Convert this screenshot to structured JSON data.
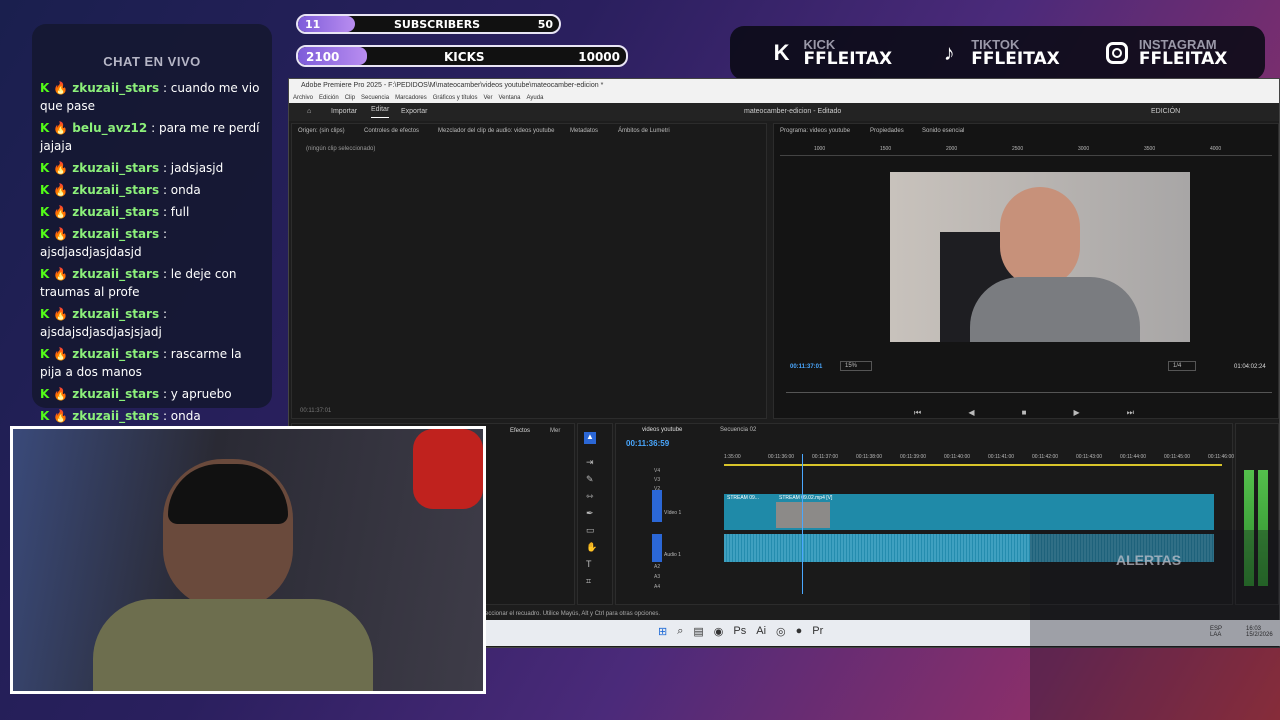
{
  "overlay": {
    "subs": {
      "label": "SUBSCRIBERS",
      "current": "11",
      "goal": "50",
      "fraction": 0.22
    },
    "kicks": {
      "label": "KICKS",
      "current": "2100",
      "goal": "10000",
      "fraction": 0.21
    },
    "socials": [
      {
        "platform": "KICK",
        "handle": "FFLEITAX",
        "icon": "kick-icon"
      },
      {
        "platform": "TIKTOK",
        "handle": "FFLEITAX",
        "icon": "tiktok-icon"
      },
      {
        "platform": "INSTAGRAM",
        "handle": "FFLEITAX",
        "icon": "instagram-icon"
      }
    ],
    "alerts": "ALERTAS"
  },
  "chat": {
    "title": "CHAT EN VIVO",
    "messages": [
      {
        "user": "zkuzaii_stars",
        "text": ": cuando me vio que pase"
      },
      {
        "user": "belu_avz12",
        "text": ": para me re perdí jajaja"
      },
      {
        "user": "zkuzaii_stars",
        "text": ": jadsjasjd"
      },
      {
        "user": "zkuzaii_stars",
        "text": ": onda"
      },
      {
        "user": "zkuzaii_stars",
        "text": ": full"
      },
      {
        "user": "zkuzaii_stars",
        "text": ": ajsdjasdjasjdasjd"
      },
      {
        "user": "zkuzaii_stars",
        "text": ": le deje con traumas al profe"
      },
      {
        "user": "zkuzaii_stars",
        "text": ": ajsdajsdjasdjasjsjadj"
      },
      {
        "user": "zkuzaii_stars",
        "text": ": rascarme la pija a dos manos"
      },
      {
        "user": "zkuzaii_stars",
        "text": ": y apruebo"
      },
      {
        "user": "zkuzaii_stars",
        "text": ": onda"
      }
    ]
  },
  "premiere": {
    "window_title": "Adobe Premiere Pro 2025 - F:\\PEDIDOS\\M\\mateocamber\\videos youtube\\mateocamber-edicion *",
    "menu": [
      "Archivo",
      "Edición",
      "Clip",
      "Secuencia",
      "Marcadores",
      "Gráficos y títulos",
      "Ver",
      "Ventana",
      "Ayuda"
    ],
    "top_tabs": [
      "Importar",
      "Editar",
      "Exportar"
    ],
    "project_title": "mateocamber-edicion - Editado",
    "workspace": "EDICIÓN",
    "source_tabs": [
      "Origen: (sin clips)",
      "Controles de efectos",
      "Mezclador del clip de audio: videos youtube",
      "Metadatos",
      "Ámbitos de Lumetri"
    ],
    "no_clip": "(ningún clip seleccionado)",
    "source_time": "00:11:37:01",
    "program_tabs": [
      "Programa: videos youtube",
      "Propiedades",
      "Sonido esencial"
    ],
    "ruler": [
      "1000",
      "1500",
      "2000",
      "2500",
      "3000",
      "3500",
      "4000"
    ],
    "program_time": "00:11:37:01",
    "zoom": "15%",
    "quality": "1/4",
    "duration": "01:04:02:24",
    "effects_tabs": [
      "Efectos",
      "Mer"
    ],
    "timeline_tabs": [
      "videos youtube",
      "Secuencia 02"
    ],
    "timeline_time": "00:11:36:59",
    "timecodes": [
      "1:35:00",
      "00:11:36:00",
      "00:11:37:00",
      "00:11:38:00",
      "00:11:39:00",
      "00:11:40:00",
      "00:11:41:00",
      "00:11:42:00",
      "00:11:43:00",
      "00:11:44:00",
      "00:11:45:00",
      "00:11:46:00"
    ],
    "tracks": [
      "V4",
      "V3",
      "V2",
      "V1",
      "A1",
      "A2",
      "A3",
      "A4"
    ],
    "video_track": "Vídeo 1",
    "audio_track": "Audio 1",
    "clip1": "STREAM 09...",
    "clip2": "STREAM 09.02.mp4 [V]",
    "status": "eccionar el recuadro. Utilice Mayús, Alt y Ctrl para otras opciones.",
    "lang": "ESP\nLAA",
    "clock": "16:03\n15/2/2026"
  }
}
